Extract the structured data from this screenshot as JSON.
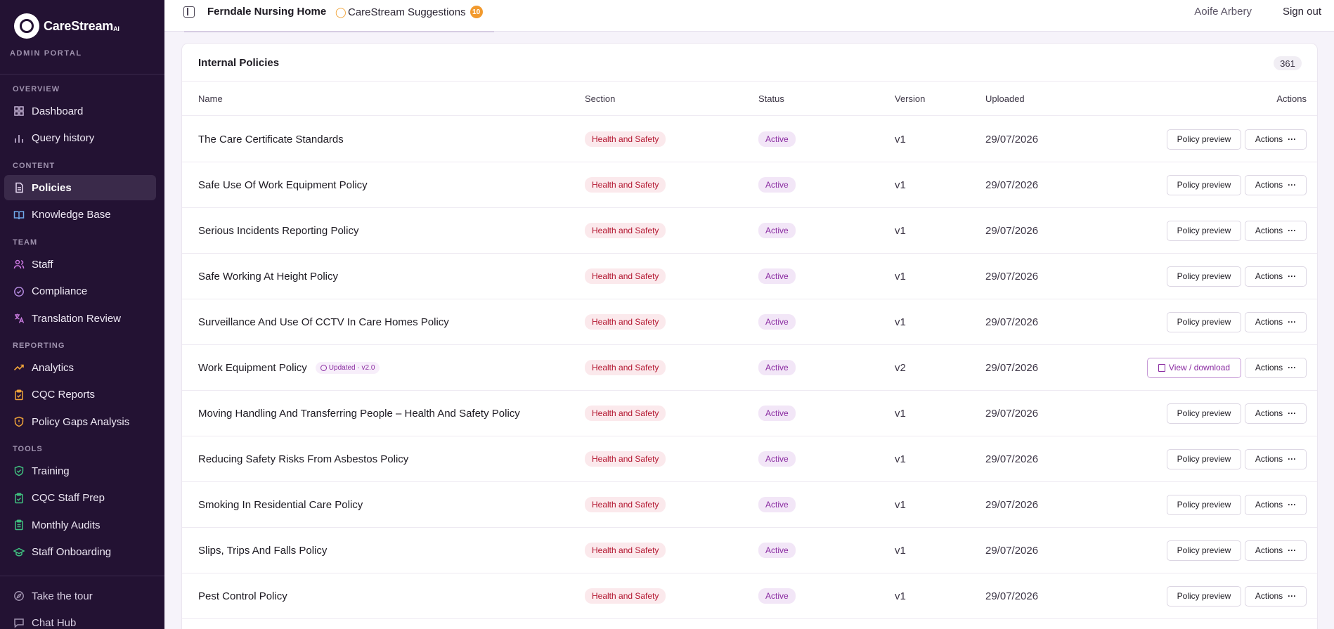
{
  "brand": {
    "name": "CareStream",
    "suffix": "AI",
    "portal": "ADMIN PORTAL"
  },
  "sidebar": {
    "sections": [
      {
        "label": "OVERVIEW",
        "items": [
          {
            "label": "Dashboard",
            "icon": "dashboard-icon"
          },
          {
            "label": "Query history",
            "icon": "bar-chart-icon"
          }
        ]
      },
      {
        "label": "CONTENT",
        "items": [
          {
            "label": "Policies",
            "icon": "document-icon",
            "active": true
          },
          {
            "label": "Knowledge Base",
            "icon": "book-icon"
          }
        ]
      },
      {
        "label": "TEAM",
        "items": [
          {
            "label": "Staff",
            "icon": "users-icon"
          },
          {
            "label": "Compliance",
            "icon": "check-circle-icon"
          },
          {
            "label": "Translation Review",
            "icon": "translate-icon"
          }
        ]
      },
      {
        "label": "REPORTING",
        "items": [
          {
            "label": "Analytics",
            "icon": "trend-icon"
          },
          {
            "label": "CQC Reports",
            "icon": "clipboard-icon"
          },
          {
            "label": "Policy Gaps Analysis",
            "icon": "shield-icon"
          }
        ]
      },
      {
        "label": "TOOLS",
        "items": [
          {
            "label": "Training",
            "icon": "shield-check-icon"
          },
          {
            "label": "CQC Staff Prep",
            "icon": "clipboard-check-icon"
          },
          {
            "label": "Monthly Audits",
            "icon": "clipboard-list-icon"
          },
          {
            "label": "Staff Onboarding",
            "icon": "graduation-cap-icon"
          }
        ]
      }
    ],
    "footer": [
      {
        "label": "Take the tour",
        "icon": "compass-icon"
      },
      {
        "label": "Chat Hub",
        "icon": "chat-icon"
      }
    ]
  },
  "topbar": {
    "home": "Ferndale Nursing Home",
    "suggestions": "CareStream Suggestions",
    "suggestions_count": "10",
    "user": "Aoife Arbery",
    "signout": "Sign out"
  },
  "table": {
    "title": "Internal Policies",
    "count": "361",
    "headers": {
      "name": "Name",
      "section": "Section",
      "status": "Status",
      "version": "Version",
      "uploaded": "Uploaded",
      "actions": "Actions"
    },
    "preview_label": "Policy preview",
    "download_label": "View / download",
    "actions_label": "Actions",
    "actions_dots": "···",
    "rows": [
      {
        "name": "The Care Certificate Standards",
        "section": "Health and Safety",
        "status": "Active",
        "version": "v1",
        "uploaded": "29/07/2026"
      },
      {
        "name": "Safe Use Of Work Equipment Policy",
        "section": "Health and Safety",
        "status": "Active",
        "version": "v1",
        "uploaded": "29/07/2026"
      },
      {
        "name": "Serious Incidents Reporting Policy",
        "section": "Health and Safety",
        "status": "Active",
        "version": "v1",
        "uploaded": "29/07/2026"
      },
      {
        "name": "Safe Working At Height Policy",
        "section": "Health and Safety",
        "status": "Active",
        "version": "v1",
        "uploaded": "29/07/2026"
      },
      {
        "name": "Surveillance And Use Of CCTV In Care Homes Policy",
        "section": "Health and Safety",
        "status": "Active",
        "version": "v1",
        "uploaded": "29/07/2026"
      },
      {
        "name": "Work Equipment Policy",
        "updated_badge": "Updated · v2.0",
        "section": "Health and Safety",
        "status": "Active",
        "version": "v2",
        "uploaded": "29/07/2026",
        "download": true
      },
      {
        "name": "Moving Handling And Transferring People – Health And Safety Policy",
        "section": "Health and Safety",
        "status": "Active",
        "version": "v1",
        "uploaded": "29/07/2026"
      },
      {
        "name": "Reducing Safety Risks From Asbestos Policy",
        "section": "Health and Safety",
        "status": "Active",
        "version": "v1",
        "uploaded": "29/07/2026"
      },
      {
        "name": "Smoking In Residential Care Policy",
        "section": "Health and Safety",
        "status": "Active",
        "version": "v1",
        "uploaded": "29/07/2026"
      },
      {
        "name": "Slips, Trips And Falls Policy",
        "section": "Health and Safety",
        "status": "Active",
        "version": "v1",
        "uploaded": "29/07/2026"
      },
      {
        "name": "Pest Control Policy",
        "section": "Health and Safety",
        "status": "Active",
        "version": "v1",
        "uploaded": "29/07/2026"
      }
    ]
  }
}
